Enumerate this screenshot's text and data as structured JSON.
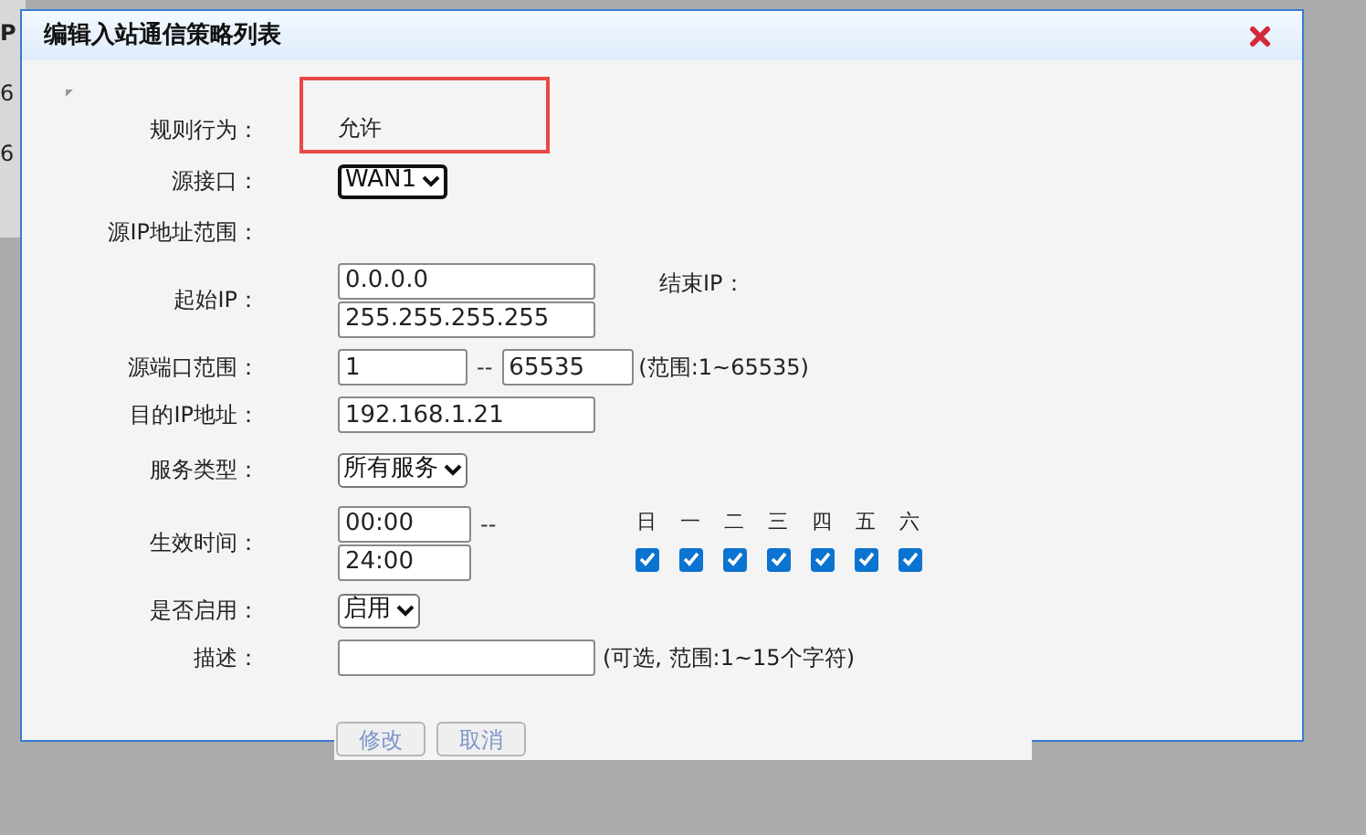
{
  "background": {
    "texts": [
      "P",
      "6",
      "6"
    ]
  },
  "dialog": {
    "title": "编辑入站通信策略列表",
    "fields": [
      {
        "kind": "text",
        "label": "规则行为：",
        "value": "允许",
        "highlighted": true
      },
      {
        "kind": "select",
        "label": "源接口：",
        "value": "WAN1",
        "focused": true
      },
      {
        "kind": "heading",
        "label": "源IP地址范围："
      },
      {
        "kind": "ip_range",
        "label": "起始IP：",
        "start": "0.0.0.0",
        "end_label": "结束IP：",
        "end": "255.255.255.255"
      },
      {
        "kind": "port_range",
        "label": "源端口范围：",
        "from": "1",
        "separator": "--",
        "to": "65535",
        "hint": "(范围:1~65535)"
      },
      {
        "kind": "input",
        "label": "目的IP地址：",
        "value": "192.168.1.21"
      },
      {
        "kind": "select",
        "label": "服务类型：",
        "value": "所有服务",
        "focused": false
      },
      {
        "kind": "time",
        "label": "生效时间：",
        "from": "00:00",
        "separator": "--",
        "to": "24:00",
        "days": [
          {
            "label": "日",
            "checked": true
          },
          {
            "label": "一",
            "checked": true
          },
          {
            "label": "二",
            "checked": true
          },
          {
            "label": "三",
            "checked": true
          },
          {
            "label": "四",
            "checked": true
          },
          {
            "label": "五",
            "checked": true
          },
          {
            "label": "六",
            "checked": true
          }
        ]
      },
      {
        "kind": "select",
        "label": "是否启用：",
        "value": "启用",
        "focused": false
      },
      {
        "kind": "input",
        "label": "描述：",
        "hint": "(可选, 范围:1~15个字符)"
      }
    ],
    "buttons": [
      {
        "label": "修改",
        "disabled": true
      },
      {
        "label": "取消",
        "disabled": true
      }
    ]
  }
}
